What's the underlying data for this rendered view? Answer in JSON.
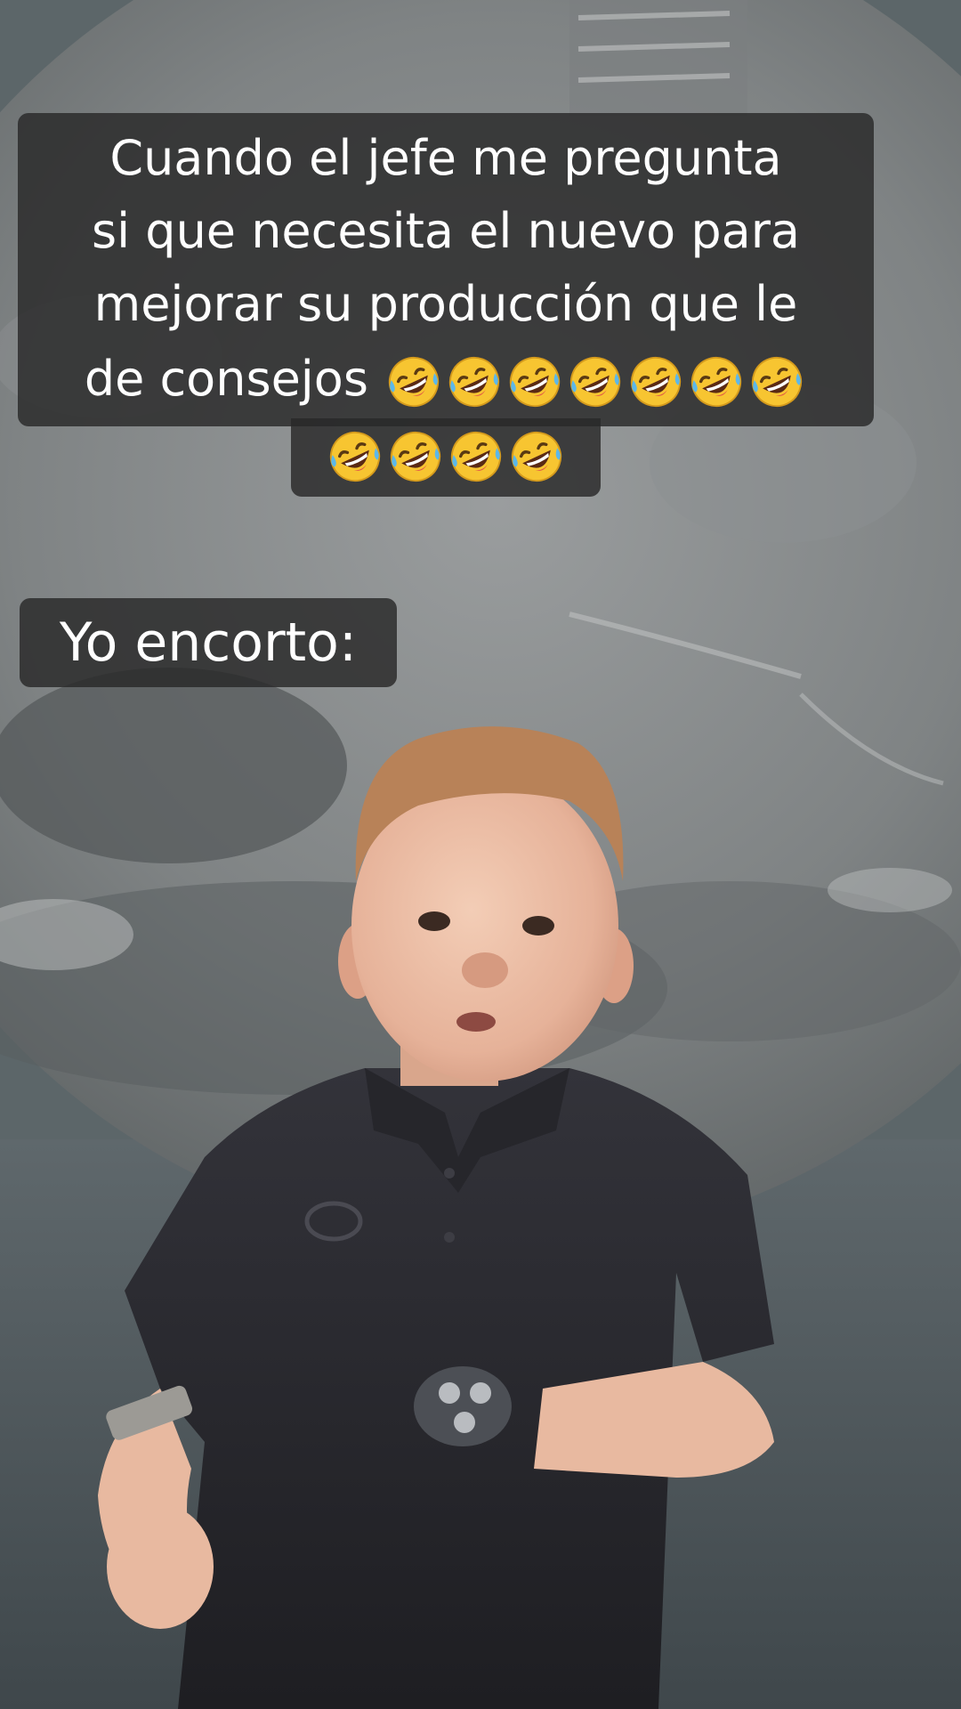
{
  "caption_top": {
    "lines": [
      "Cuando el jefe me pregunta",
      "si que necesita el nuevo para",
      "mejorar su producción que le",
      "de consejos"
    ],
    "emoji_line4_count": 7,
    "emoji_line5_count": 4,
    "emoji_name": "rolling-on-the-floor-laughing-emoji"
  },
  "caption_second": {
    "text": "Yo encorto:"
  },
  "colors": {
    "caption_bg": "#2b2b2b",
    "caption_text": "#ffffff",
    "shirt": "#2a2a2e",
    "skin": "#e8b9a0",
    "hair": "#b7825a",
    "wall": "#6d7275"
  }
}
